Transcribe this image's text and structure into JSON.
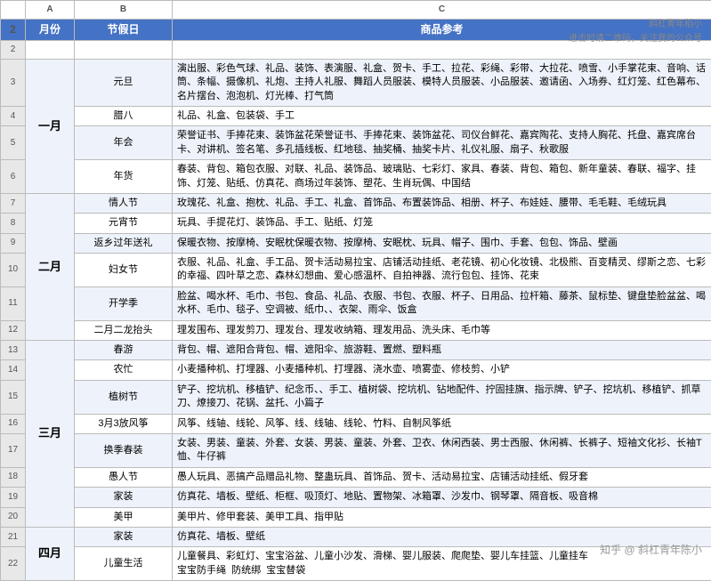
{
  "watermark": {
    "line1": "斜杠青年稻小",
    "line2": "进击时请二维码，关注我的公众号"
  },
  "logo": {
    "text": "知乎 @ 斜杠青年陈小"
  },
  "col_headers": [
    "月份",
    "节假日",
    "商品参考"
  ],
  "rows": [
    {
      "row": "2",
      "month": "",
      "festival": "",
      "content": "",
      "is_header": true
    },
    {
      "row": "3",
      "month": "一月",
      "festival": "元旦",
      "content": "演出服、彩色气球、礼品、装饰、表演服、礼盒、贺卡、手工、拉花、彩绳、彩带、大拉花、喷雪、小手掌花束、音响、话筒、条幅、摄像机、礼炮、主持人礼服、舞蹈人员服装、模特人员服装、小品服装、邀请函、入场券、红灯笼、红色幕布、名片摆台、泡泡机、灯光棒、打气筒"
    },
    {
      "row": "4",
      "month": "",
      "festival": "腊八",
      "content": "礼品、礼盒、包装袋、手工"
    },
    {
      "row": "5",
      "month": "",
      "festival": "年会",
      "content": "荣誉证书、手捧花束、装饰盆花荣誉证书、手捧花束、装饰盆花、司仪台鲜花、嘉宾陶花、支持人胸花、托盘、嘉宾席台卡、对讲机、签名笔、多孔插线板、红地毯、抽奖桶、抽奖卡片、礼仪礼服、扇子、秋歌服"
    },
    {
      "row": "6",
      "month": "",
      "festival": "年货",
      "content": "春装、背包、箱包衣服、对联、礼品、装饰品、玻璃贴、七彩灯、家具、春装、背包、箱包、新年童装、春联、福字、挂饰、灯笼、贴纸、仿真花、商场过年装饰、塑花、生肖玩偶、中国结"
    },
    {
      "row": "7",
      "month": "二月",
      "festival": "情人节",
      "content": "玫瑰花、礼盒、抱枕、礼品、手工、礼盒、首饰品、布置装饰品、相册、杯子、布娃娃、腰带、毛毛鞋、毛绒玩具"
    },
    {
      "row": "8",
      "month": "",
      "festival": "元宵节",
      "content": "玩具、手提花灯、装饰品、手工、贴纸、灯笼"
    },
    {
      "row": "9",
      "month": "",
      "festival": "返乡过年送礼",
      "content": "保暖衣物、按摩椅、安眠枕保暖衣物、按摩椅、安眠枕、玩具、帽子、围巾、手套、包包、饰品、壁画"
    },
    {
      "row": "10",
      "month": "",
      "festival": "妇女节",
      "content": "衣服、礼品、礼盒、手工品、贺卡活动易拉宝、店铺活动挂纸、老花镜、初心化妆镜、北极熊、百变精灵、缪斯之恋、七彩的幸福、四叶草之恋、森林幻想曲、爱心感温杯、自拍神器、流行包包、挂饰、花束"
    },
    {
      "row": "11",
      "month": "",
      "festival": "开学季",
      "content": "脸盆、喝水杯、毛巾、书包、食品、礼品、衣服、书包、衣服、杯子、日用品、拉杆箱、藤茶、鼠标垫、键盘垫脸盆盆、喝水杯、毛巾、毯子、空调被、纸巾、、衣架、雨伞、饭盒"
    },
    {
      "row": "12",
      "month": "",
      "festival": "二月二龙抬头",
      "content": "理发围布、理发剪刀、理发台、理发收纳箱、理发用品、洗头床、毛巾等"
    },
    {
      "row": "13",
      "month": "三月",
      "festival": "春游",
      "content": "背包、帽、遮阳合背包、帽、遮阳伞、旅游鞋、置燃、塑料瓶"
    },
    {
      "row": "14",
      "month": "",
      "festival": "农忙",
      "content": "小麦播种机、打埋器、小麦播种机、打埋器、浇水壶、喷雾壶、修枝剪、小铲"
    },
    {
      "row": "15",
      "month": "",
      "festival": "植树节",
      "content": "铲子、挖坑机、移植铲、纪念币、、手工、植树袋、挖坑机、钻地配件、拧固挂旗、指示牌、铲子、挖坑机、移植铲、抓草刀、燎接刀、花锅、盆托、小篇子"
    },
    {
      "row": "16",
      "month": "",
      "festival": "3月3放风筝",
      "content": "风筝、线轴、线轮、风筝、线、线轴、线轮、竹料、自制风筝纸"
    },
    {
      "row": "17",
      "month": "",
      "festival": "换季春装",
      "content": "女装、男装、童装、外套、女装、男装、童装、外套、卫衣、休闲西装、男士西服、休闲裤、长裤子、短袖文化衫、长袖T恤、牛仔裤"
    },
    {
      "row": "18",
      "month": "",
      "festival": "愚人节",
      "content": "愚人玩具、恶搞产品赠品礼物、整蛊玩具、首饰品、贺卡、活动易拉宝、店铺活动挂纸、假牙套"
    },
    {
      "row": "19",
      "month": "",
      "festival": "家装",
      "content": "仿真花、墙板、壁纸、柜框、吸顶灯、地贴、置物架、冰箱罩、沙发巾、钢琴罩、隔音板、吸音棉"
    },
    {
      "row": "20",
      "month": "",
      "festival": "美甲",
      "content": "美甲片、修甲套装、美甲工具、指甲贴"
    },
    {
      "row": "21",
      "month": "四月",
      "festival": "家装",
      "content": "仿真花、墙板、壁纸"
    },
    {
      "row": "22",
      "month": "",
      "festival": "儿童生活",
      "content": "儿童餐具、彩虹灯、宝宝浴盆、儿童小沙发、滑梯、婴儿服装、爬爬垫、婴儿车挂篮、儿童挂车\n宝宝防手绳  防统绑  宝宝替袋"
    }
  ]
}
